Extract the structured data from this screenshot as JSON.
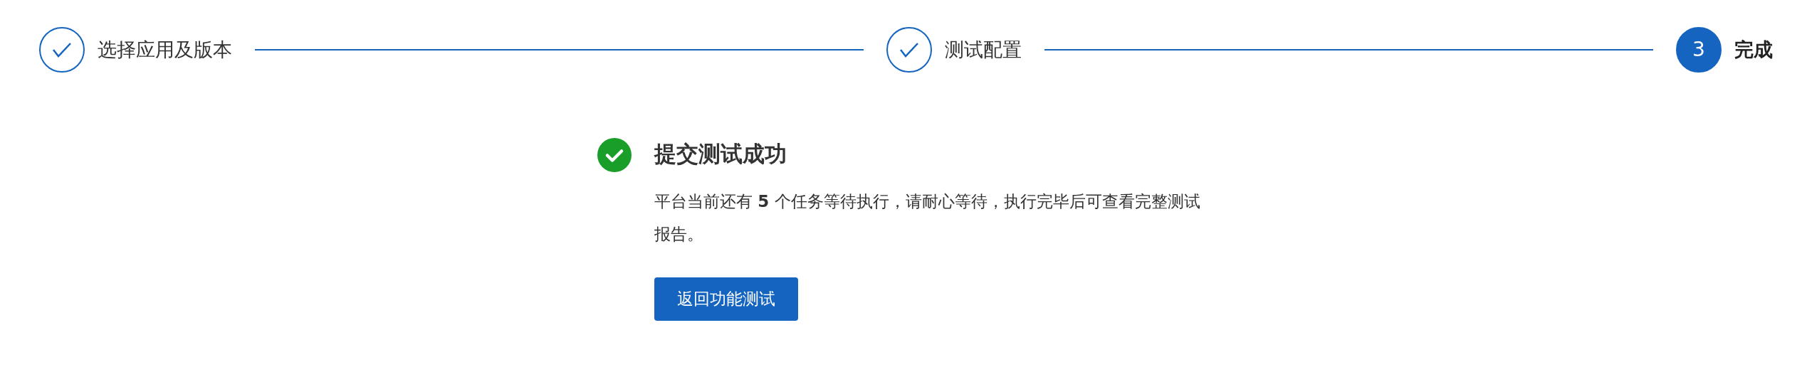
{
  "steps": [
    {
      "label": "选择应用及版本",
      "completed": true,
      "selected": false
    },
    {
      "label": "测试配置",
      "completed": true,
      "selected": false
    },
    {
      "label": "完成",
      "number": "3",
      "completed": false,
      "selected": true
    }
  ],
  "result": {
    "title": "提交测试成功",
    "message": "平台当前还有 **5** 个任务等待执行，请耐心等待，执行完毕后可查看完整测试报告。",
    "button": "返回功能测试"
  }
}
